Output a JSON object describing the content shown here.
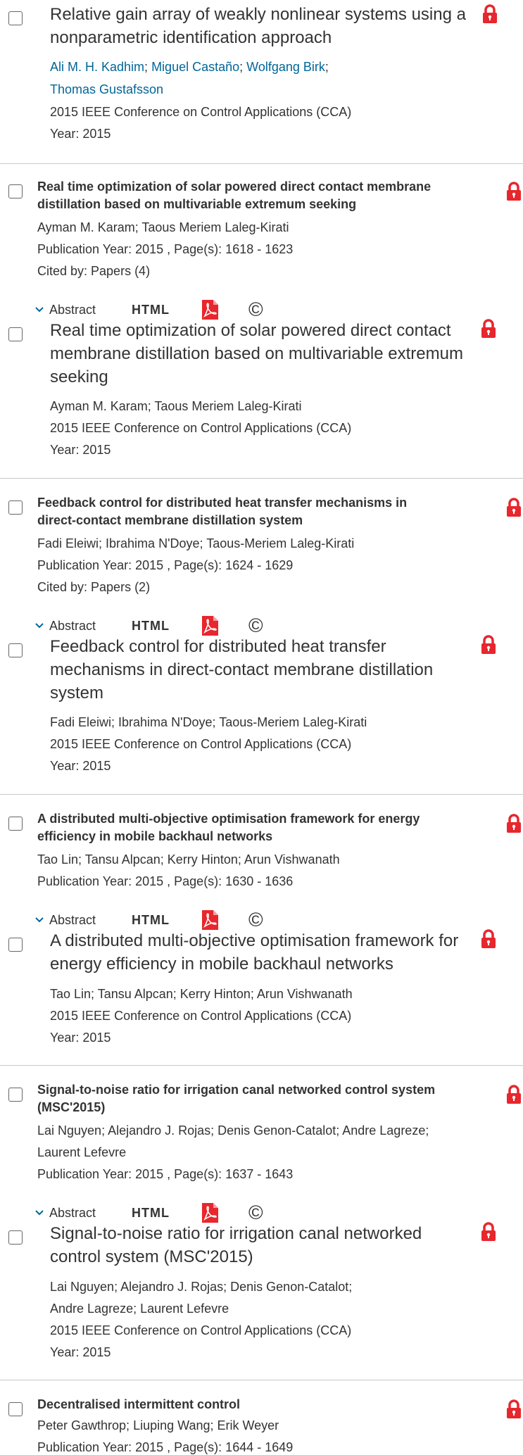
{
  "colors": {
    "lock": "#e8262d",
    "link": "#006699",
    "text": "#333333"
  },
  "actions": {
    "abstract": "Abstract",
    "html": "HTML",
    "copyright": "©",
    "pdf_icon": "pdf-icon"
  },
  "first_card": {
    "title_line1": "Relative gain array of weakly nonlinear systems using a",
    "title_line2": "nonparametric identification approach",
    "authors": [
      "Ali M. H. Kadhim",
      "Miguel Castaño",
      "Wolfgang Birk",
      "Thomas Gustafsson"
    ],
    "conference": "2015 IEEE Conference on Control Applications (CCA)",
    "year": "Year: 2015"
  },
  "items": [
    {
      "title_line1": "Real time optimization of solar powered direct contact membrane",
      "title_line2": "distillation based on multivariable extremum seeking",
      "authors": "Ayman M. Karam; Taous Meriem Laleg-Kirati",
      "pubinfo": "Publication Year: 2015 , Page(s): 1618  -  1623",
      "cited": "Cited by: Papers (4)",
      "detail_title_lines": [
        "Real time optimization of solar powered direct contact",
        "membrane distillation based on multivariable extremum",
        "seeking"
      ],
      "detail_authors": "Ayman M. Karam; Taous Meriem Laleg-Kirati",
      "detail_conference": "2015 IEEE Conference on Control Applications (CCA)",
      "detail_year": "Year: 2015"
    },
    {
      "title_line1": "Feedback control for distributed heat transfer mechanisms in",
      "title_line2": "direct-contact membrane distillation system",
      "authors": "Fadi Eleiwi; Ibrahima N'Doye; Taous-Meriem Laleg-Kirati",
      "pubinfo": "Publication Year: 2015 , Page(s): 1624  -  1629",
      "cited": "Cited by: Papers (2)",
      "detail_title_lines": [
        "Feedback control for distributed heat transfer",
        "mechanisms in direct-contact membrane distillation",
        "system"
      ],
      "detail_authors": "Fadi Eleiwi; Ibrahima N'Doye; Taous-Meriem Laleg-Kirati",
      "detail_conference": "2015 IEEE Conference on Control Applications (CCA)",
      "detail_year": "Year: 2015"
    },
    {
      "title_line1": "A distributed multi-objective optimisation framework for energy",
      "title_line2": "efficiency in mobile backhaul networks",
      "authors": "Tao Lin; Tansu Alpcan; Kerry Hinton; Arun Vishwanath",
      "pubinfo": "Publication Year: 2015 , Page(s): 1630  -  1636",
      "detail_title_lines": [
        "A distributed multi-objective optimisation framework for",
        "energy efficiency in mobile backhaul networks"
      ],
      "detail_authors": "Tao Lin; Tansu Alpcan; Kerry Hinton; Arun Vishwanath",
      "detail_conference": "2015 IEEE Conference on Control Applications (CCA)",
      "detail_year": "Year: 2015"
    },
    {
      "title_line1": "Signal-to-noise ratio for irrigation canal networked control system",
      "title_line2": "(MSC'2015)",
      "authors_line1": "Lai Nguyen; Alejandro J. Rojas; Denis Genon-Catalot; Andre Lagreze;",
      "authors_line2": "Laurent Lefevre",
      "pubinfo": "Publication Year: 2015 , Page(s): 1637  -  1643",
      "detail_title_lines": [
        "Signal-to-noise ratio for irrigation canal networked",
        "control system (MSC'2015)"
      ],
      "detail_authors_line1": "Lai Nguyen; Alejandro J. Rojas; Denis Genon-Catalot;",
      "detail_authors_line2": "Andre Lagreze; Laurent Lefevre",
      "detail_conference": "2015 IEEE Conference on Control Applications (CCA)",
      "detail_year": "Year: 2015"
    },
    {
      "title_line1": "Decentralised intermittent control",
      "authors": "Peter Gawthrop; Liuping Wang; Erik Weyer",
      "pubinfo": "Publication Year: 2015 , Page(s): 1644  -  1649"
    }
  ]
}
